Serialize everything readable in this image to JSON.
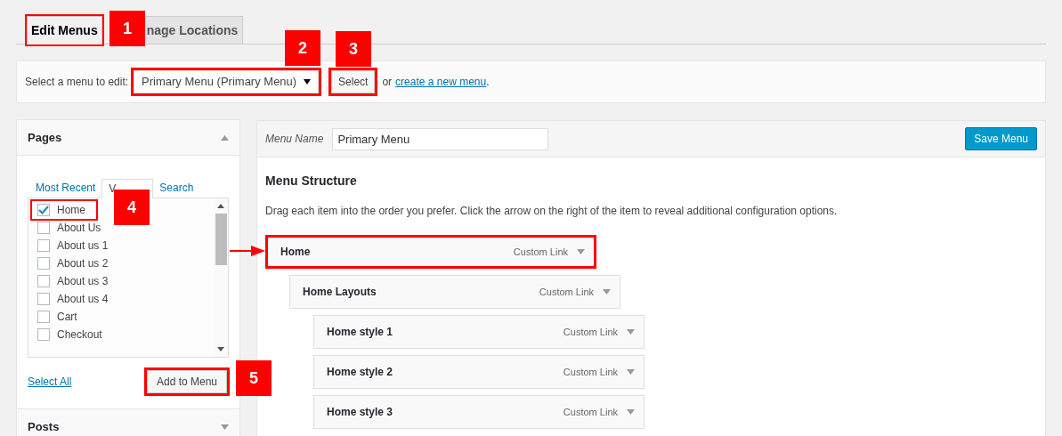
{
  "tabs": [
    {
      "label": "Edit Menus",
      "selected": true,
      "highlighted": true
    },
    {
      "label": "nage Locations",
      "selected": false,
      "highlighted": false
    }
  ],
  "menu_select": {
    "label": "Select a menu to edit:",
    "value": "Primary Menu (Primary Menu)",
    "highlighted": true,
    "button": "Select",
    "button_highlighted": true,
    "or_text": "or",
    "link": "create a new menu",
    "tail": "."
  },
  "left_panel": [
    {
      "title": "Pages",
      "expanded": true,
      "tabs": [
        {
          "label": "Most Recent",
          "selected": false
        },
        {
          "label": "V",
          "selected": true
        },
        {
          "label": "Search",
          "selected": false
        }
      ],
      "items": [
        {
          "label": "Home",
          "checked": true,
          "highlighted": true
        },
        {
          "label": "About Us",
          "checked": false,
          "highlighted": false
        },
        {
          "label": "About us 1",
          "checked": false,
          "highlighted": false
        },
        {
          "label": "About us 2",
          "checked": false,
          "highlighted": false
        },
        {
          "label": "About us 3",
          "checked": false,
          "highlighted": false
        },
        {
          "label": "About us 4",
          "checked": false,
          "highlighted": false
        },
        {
          "label": "Cart",
          "checked": false,
          "highlighted": false
        },
        {
          "label": "Checkout",
          "checked": false,
          "highlighted": false
        }
      ],
      "select_all": "Select All",
      "add_button": "Add to Menu",
      "add_highlighted": true
    },
    {
      "title": "Posts",
      "expanded": false
    }
  ],
  "menu_editor": {
    "name_label": "Menu Name",
    "name_value": "Primary Menu",
    "save_button": "Save Menu",
    "heading": "Menu Structure",
    "instructions": "Drag each item into the order you prefer. Click the arrow on the right of the item to reveal additional configuration options.",
    "items": [
      {
        "title": "Home",
        "type": "Custom Link",
        "highlighted": true,
        "children": [
          {
            "title": "Home Layouts",
            "type": "Custom Link",
            "highlighted": false,
            "children": [
              {
                "title": "Home style 1",
                "type": "Custom Link",
                "highlighted": false
              },
              {
                "title": "Home style 2",
                "type": "Custom Link",
                "highlighted": false
              },
              {
                "title": "Home style 3",
                "type": "Custom Link",
                "highlighted": false
              }
            ]
          }
        ]
      }
    ]
  },
  "callouts": [
    {
      "label": "1"
    },
    {
      "label": "2"
    },
    {
      "label": "3"
    },
    {
      "label": "4"
    },
    {
      "label": "5"
    }
  ]
}
